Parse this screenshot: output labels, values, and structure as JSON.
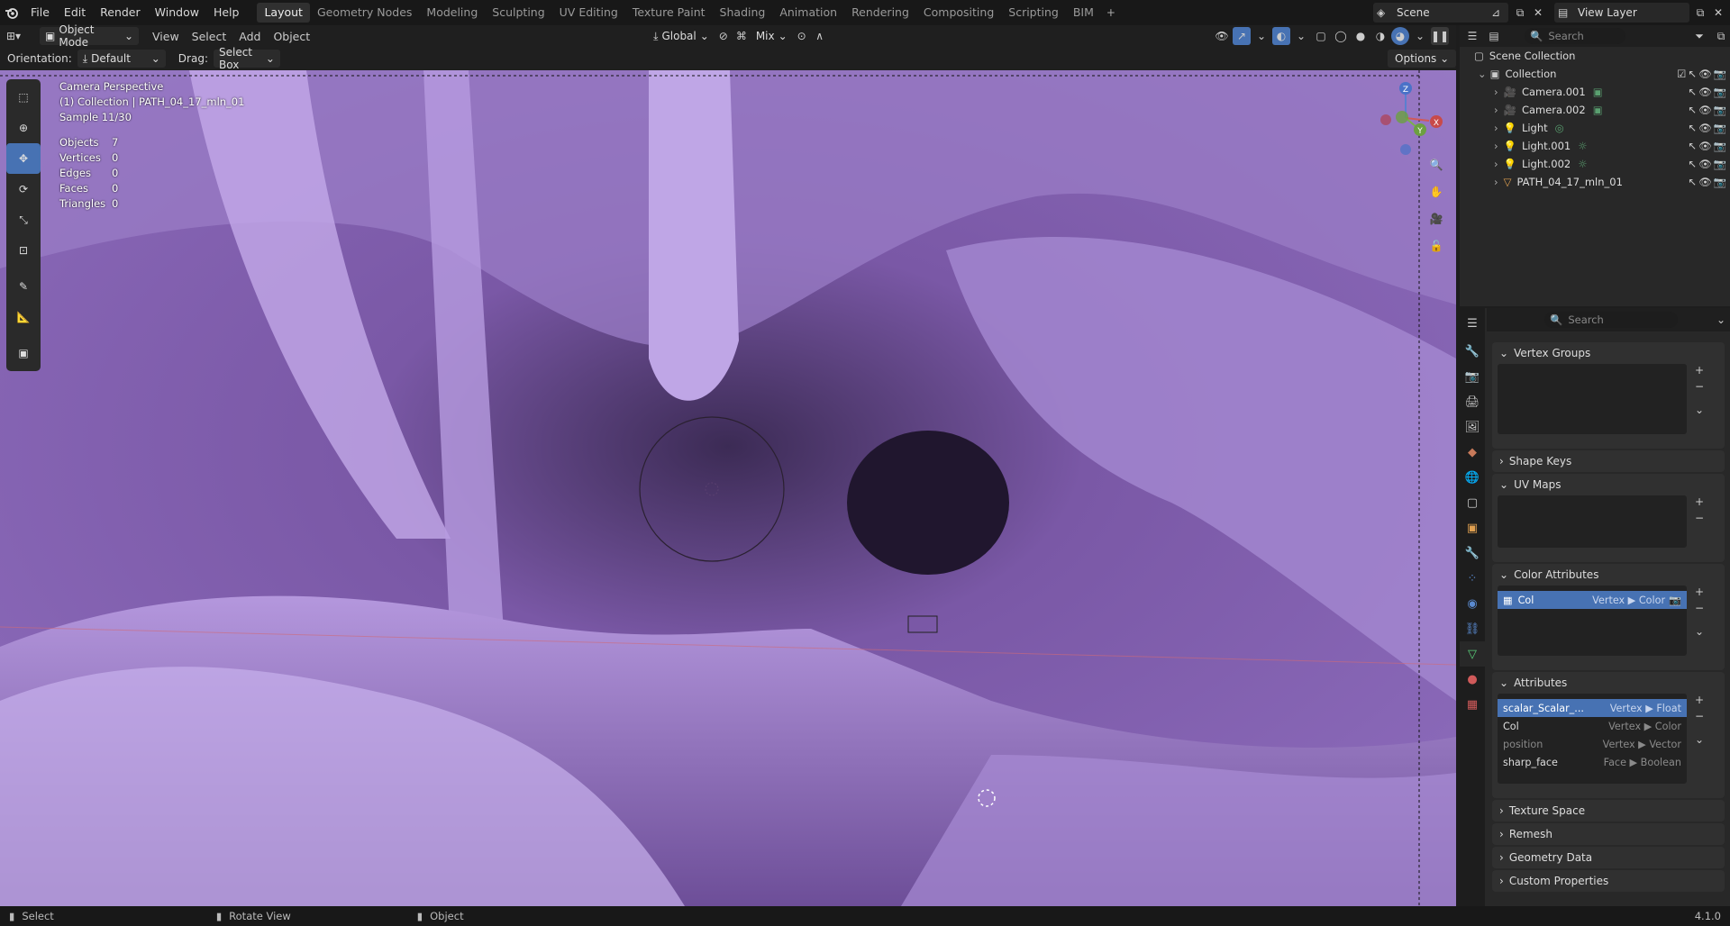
{
  "app": {
    "version": "4.1.0"
  },
  "menu": [
    "File",
    "Edit",
    "Render",
    "Window",
    "Help"
  ],
  "workspaces": [
    "Layout",
    "Geometry Nodes",
    "Modeling",
    "Sculpting",
    "UV Editing",
    "Texture Paint",
    "Shading",
    "Animation",
    "Rendering",
    "Compositing",
    "Scripting",
    "BIM"
  ],
  "active_workspace": "Layout",
  "scene": {
    "name": "Scene",
    "view_layer": "View Layer"
  },
  "viewport_header": {
    "mode": "Object Mode",
    "menus": [
      "View",
      "Select",
      "Add",
      "Object"
    ],
    "transform_orientation": "Global",
    "snap_mode": "Mix"
  },
  "tool_header": {
    "orientation_label": "Orientation:",
    "orientation_value": "Default",
    "drag_label": "Drag:",
    "drag_value": "Select Box",
    "options": "Options"
  },
  "viewport_overlay": {
    "camera": "Camera Perspective",
    "collection": "(1) Collection | PATH_04_17_mln_01",
    "sample": "Sample 11/30",
    "stats": [
      {
        "label": "Objects",
        "value": "7"
      },
      {
        "label": "Vertices",
        "value": "0"
      },
      {
        "label": "Edges",
        "value": "0"
      },
      {
        "label": "Faces",
        "value": "0"
      },
      {
        "label": "Triangles",
        "value": "0"
      }
    ]
  },
  "gizmo": {
    "x": "X",
    "y": "Y",
    "z": "Z"
  },
  "outliner": {
    "search_placeholder": "Search",
    "root": "Scene Collection",
    "collection": "Collection",
    "items": [
      "Camera.001",
      "Camera.002",
      "Light",
      "Light.001",
      "Light.002",
      "PATH_04_17_mln_01"
    ]
  },
  "properties": {
    "search_placeholder": "Search",
    "panels": {
      "vertex_groups": "Vertex Groups",
      "shape_keys": "Shape Keys",
      "uv_maps": "UV Maps",
      "color_attributes": "Color Attributes",
      "attributes": "Attributes",
      "texture_space": "Texture Space",
      "remesh": "Remesh",
      "geometry_data": "Geometry Data",
      "custom_properties": "Custom Properties"
    },
    "color_attributes": [
      {
        "name": "Col",
        "domain": "Vertex ▶ Color"
      }
    ],
    "attributes": [
      {
        "name": "scalar_Scalar_...",
        "domain": "Vertex ▶ Float"
      },
      {
        "name": "Col",
        "domain": "Vertex ▶ Color"
      },
      {
        "name": "position",
        "domain": "Vertex ▶ Vector"
      },
      {
        "name": "sharp_face",
        "domain": "Face ▶ Boolean"
      }
    ]
  },
  "status_bar": {
    "select": "Select",
    "rotate": "Rotate View",
    "object": "Object"
  }
}
